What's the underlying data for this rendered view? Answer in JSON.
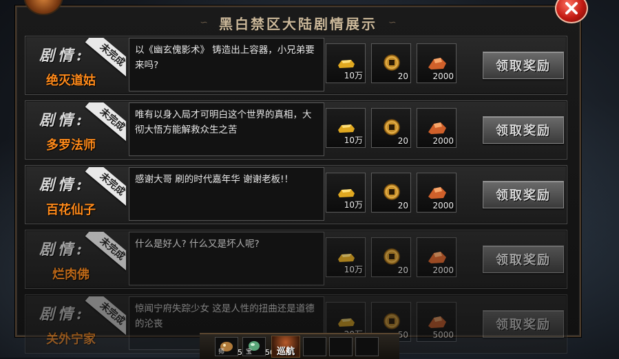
{
  "window": {
    "title": "黑白禁区大陆剧情展示"
  },
  "common": {
    "story_label": "剧情:",
    "status_incomplete": "未完成",
    "claim_label": "领取奖励"
  },
  "quests": [
    {
      "npc": "绝灭道姑",
      "description": "以《幽玄傀影术》 铸造出上容器，小兄弟要来吗?",
      "rewards": [
        {
          "icon": "gold-ingot-icon",
          "amount": "10万"
        },
        {
          "icon": "copper-coin-icon",
          "amount": "20"
        },
        {
          "icon": "fire-shard-icon",
          "amount": "2000"
        }
      ]
    },
    {
      "npc": "多罗法师",
      "description": "唯有以身入局才可明白这个世界的真相，大彻大悟方能解救众生之苦",
      "rewards": [
        {
          "icon": "gold-ingot-icon",
          "amount": "10万"
        },
        {
          "icon": "copper-coin-icon",
          "amount": "20"
        },
        {
          "icon": "fire-shard-icon",
          "amount": "2000"
        }
      ]
    },
    {
      "npc": "百花仙子",
      "description": "感谢大哥 刷的时代嘉年华 谢谢老板!！",
      "rewards": [
        {
          "icon": "gold-ingot-icon",
          "amount": "10万"
        },
        {
          "icon": "copper-coin-icon",
          "amount": "20"
        },
        {
          "icon": "fire-shard-icon",
          "amount": "2000"
        }
      ]
    },
    {
      "npc": "烂肉佛",
      "description": "什么是好人? 什么又是坏人呢?",
      "rewards": [
        {
          "icon": "gold-ingot-icon",
          "amount": "10万"
        },
        {
          "icon": "copper-coin-icon",
          "amount": "20"
        },
        {
          "icon": "fire-shard-icon",
          "amount": "2000"
        }
      ]
    },
    {
      "npc": "关外宁家",
      "description": "惊闻宁府失踪少女 这是人性的扭曲还是道德的沦丧",
      "rewards": [
        {
          "icon": "gold-ingot-icon",
          "amount": "20万"
        },
        {
          "icon": "copper-coin-icon",
          "amount": "50"
        },
        {
          "icon": "fire-shard-icon",
          "amount": "5000"
        }
      ]
    }
  ],
  "bottom_bar": {
    "item1": {
      "icon": "pet-icon",
      "tag": "师",
      "amount": "50"
    },
    "item2": {
      "icon": "jade-icon",
      "tag": "宝",
      "amount": "50"
    },
    "patrol_label": "巡航"
  },
  "colors": {
    "npc_name": "#ff8a1a",
    "title_text": "#cbb89a",
    "close_button": "#c21a12"
  }
}
